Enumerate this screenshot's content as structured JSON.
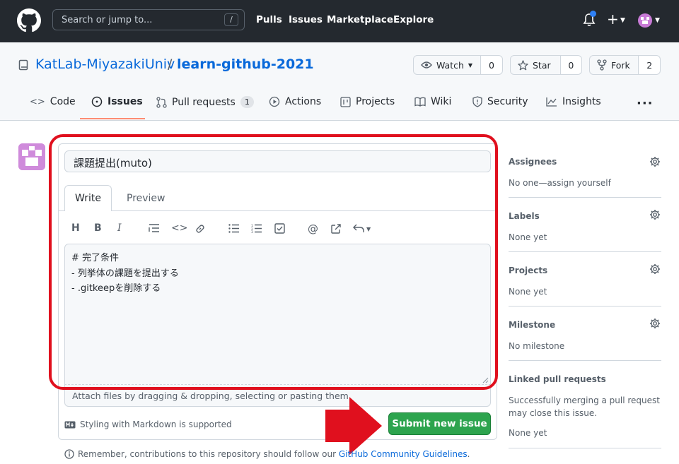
{
  "topbar": {
    "search_placeholder": "Search or jump to...",
    "search_shortcut": "/",
    "nav": [
      "Pulls",
      "Issues",
      "Marketplace",
      "Explore"
    ],
    "plus_label": "+"
  },
  "repo": {
    "owner": "KatLab-MiyazakiUniv",
    "separator": "/",
    "name": "learn-github-2021",
    "watch_label": "Watch",
    "watch_count": "0",
    "star_label": "Star",
    "star_count": "0",
    "fork_label": "Fork",
    "fork_count": "2"
  },
  "tabs": {
    "code": "Code",
    "issues": "Issues",
    "pulls": "Pull requests",
    "pulls_count": "1",
    "actions": "Actions",
    "projects": "Projects",
    "wiki": "Wiki",
    "security": "Security",
    "insights": "Insights",
    "more": "···"
  },
  "issue_form": {
    "title_value": "課題提出(muto)",
    "write_tab": "Write",
    "preview_tab": "Preview",
    "body_value": "# 完了条件\n- 列挙体の課題を提出する\n- .gitkeepを削除する",
    "attach_hint": "Attach files by dragging & dropping, selecting or pasting them.",
    "markdown_note": "Styling with Markdown is supported",
    "submit_label": "Submit new issue",
    "md_badge": "M↓"
  },
  "footer": {
    "note_prefix": "Remember, contributions to this repository should follow our ",
    "note_link": "GitHub Community Guidelines",
    "note_suffix": "."
  },
  "sidebar": {
    "assignees_title": "Assignees",
    "assignees_value": "No one—assign yourself",
    "labels_title": "Labels",
    "labels_value": "None yet",
    "projects_title": "Projects",
    "projects_value": "None yet",
    "milestone_title": "Milestone",
    "milestone_value": "No milestone",
    "linked_title": "Linked pull requests",
    "linked_desc": "Successfully merging a pull request may close this issue.",
    "linked_value": "None yet"
  },
  "colors": {
    "topbar_bg": "#24292f",
    "link_blue": "#0969da",
    "submit_green": "#2da44e",
    "annotation_red": "#e0101e",
    "tab_underline": "#fd8c73"
  }
}
